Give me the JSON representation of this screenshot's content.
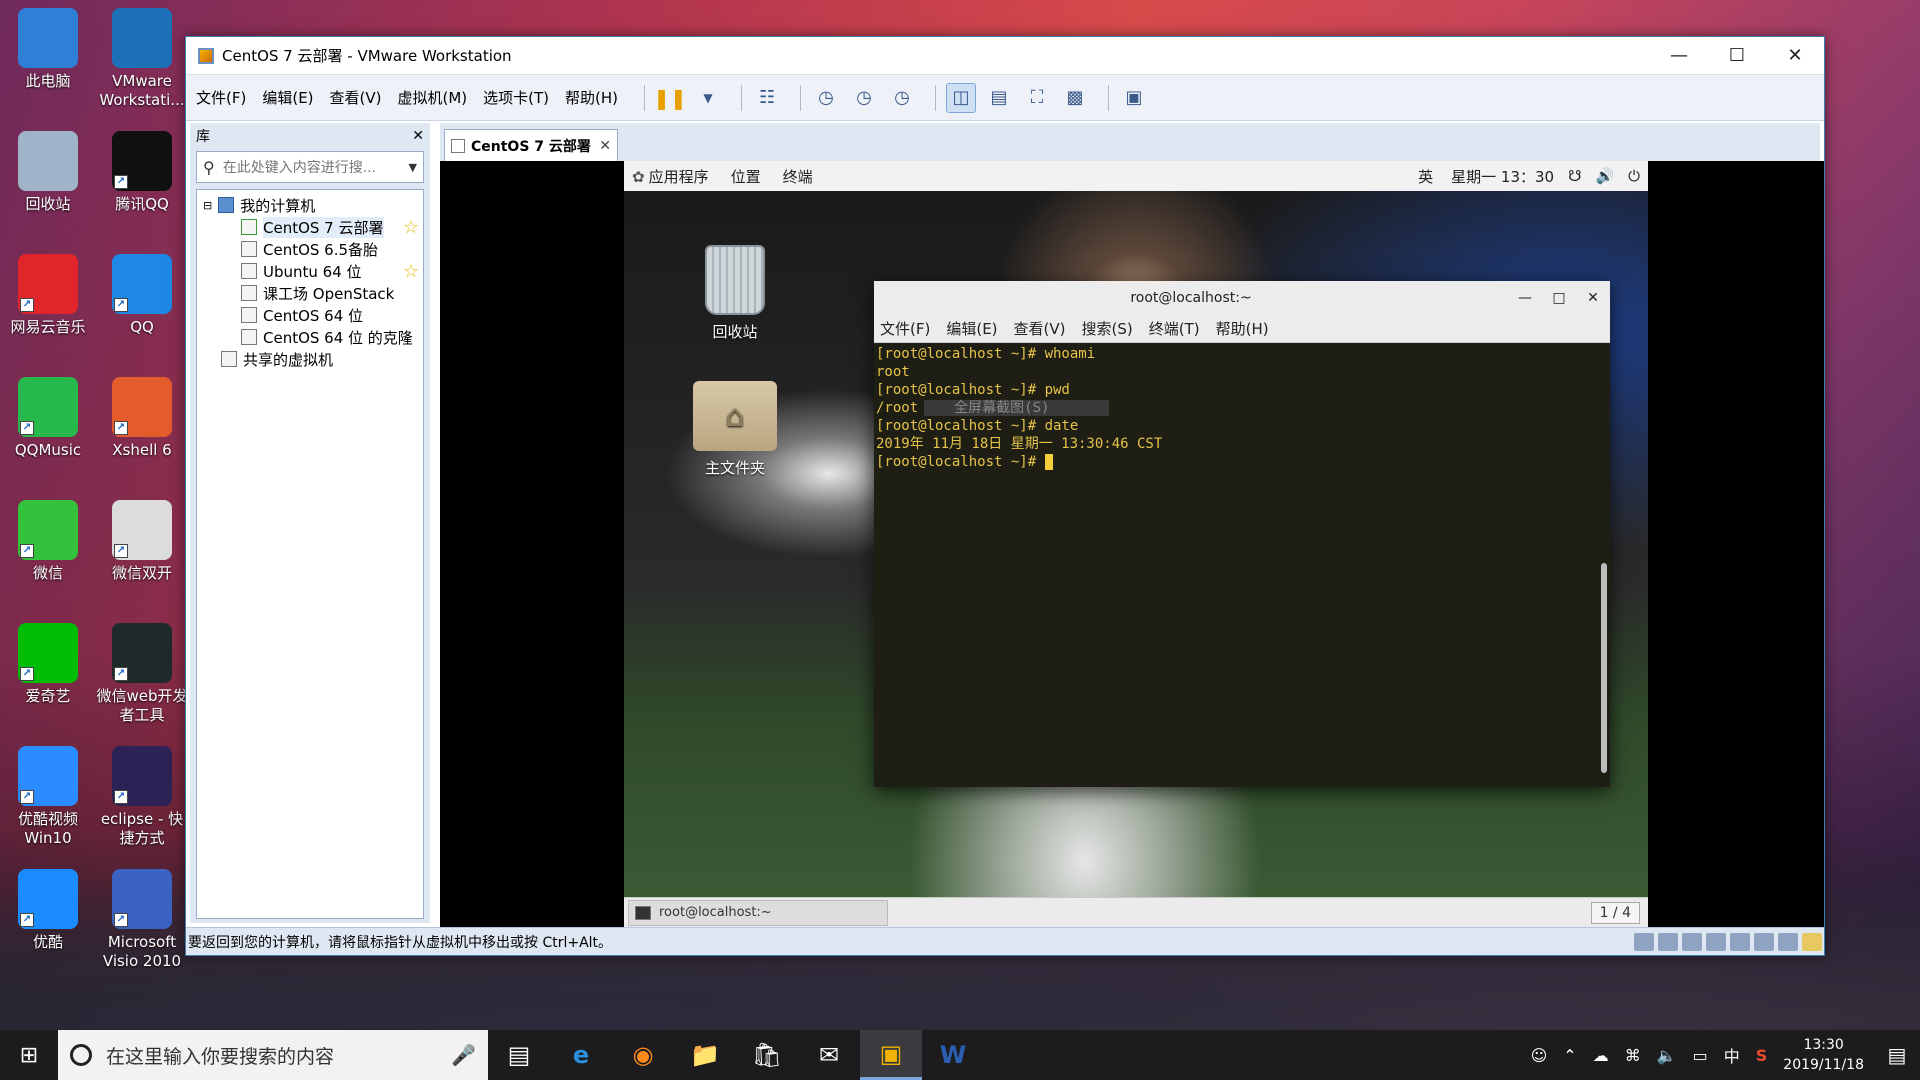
{
  "desktop": {
    "icons": [
      {
        "label": "此电脑",
        "icon": "this-pc-icon",
        "color": "#2f7fd6"
      },
      {
        "label": "VMware Workstati...",
        "icon": "vmware-icon",
        "color": "#1d6fb8"
      },
      {
        "label": "回收站",
        "icon": "recycle-bin-icon",
        "color": "#9fb4c8"
      },
      {
        "label": "腾讯QQ",
        "icon": "qq-penguin-icon",
        "color": "#111111"
      },
      {
        "label": "网易云音乐",
        "icon": "netease-music-icon",
        "color": "#e0262a"
      },
      {
        "label": "QQ",
        "icon": "qq-icon",
        "color": "#1e88e5"
      },
      {
        "label": "QQMusic",
        "icon": "qqmusic-icon",
        "color": "#27b94c"
      },
      {
        "label": "Xshell 6",
        "icon": "xshell-icon",
        "color": "#e45c2c"
      },
      {
        "label": "微信",
        "icon": "wechat-icon",
        "color": "#32c23c"
      },
      {
        "label": "微信双开",
        "icon": "wechat-dual-icon",
        "color": "#dcdcdc"
      },
      {
        "label": "爱奇艺",
        "icon": "iqiyi-icon",
        "color": "#00be06"
      },
      {
        "label": "微信web开发者工具",
        "icon": "wechat-devtools-icon",
        "color": "#1f2a2a"
      },
      {
        "label": "优酷视频 Win10",
        "icon": "youku-win10-icon",
        "color": "#2b8cff"
      },
      {
        "label": "eclipse - 快捷方式",
        "icon": "eclipse-icon",
        "color": "#2c2255"
      },
      {
        "label": "优酷",
        "icon": "youku-icon",
        "color": "#1a8cff"
      },
      {
        "label": "Microsoft Visio 2010",
        "icon": "visio-icon",
        "color": "#3b63c4"
      }
    ]
  },
  "vmware": {
    "title": "CentOS 7 云部署 - VMware Workstation",
    "menu": [
      "文件(F)",
      "编辑(E)",
      "查看(V)",
      "虚拟机(M)",
      "选项卡(T)",
      "帮助(H)"
    ],
    "library": {
      "title": "库",
      "search_placeholder": "在此处键入内容进行搜...",
      "root": "我的计算机",
      "vms": [
        {
          "name": "CentOS 7 云部署",
          "starred": true
        },
        {
          "name": "CentOS 6.5备胎",
          "starred": false
        },
        {
          "name": "Ubuntu 64 位",
          "starred": true
        },
        {
          "name": "课工场 OpenStack",
          "starred": false
        },
        {
          "name": "CentOS 64 位",
          "starred": false
        },
        {
          "name": "CentOS 64 位 的克隆",
          "starred": false
        }
      ],
      "shared": "共享的虚拟机"
    },
    "tab_label": "CentOS 7 云部署",
    "status_text": "要返回到您的计算机，请将鼠标指针从虚拟机中移出或按 Ctrl+Alt。"
  },
  "guest": {
    "topbar": {
      "apps": "应用程序",
      "places": "位置",
      "terminal": "终端",
      "lang": "英",
      "clock": "星期一 13：30"
    },
    "desktop_icons": [
      "回收站",
      "主文件夹"
    ],
    "terminal": {
      "title": "root@localhost:~",
      "menu": [
        "文件(F)",
        "编辑(E)",
        "查看(V)",
        "搜索(S)",
        "终端(T)",
        "帮助(H)"
      ],
      "lines": [
        "[root@localhost ~]# whoami",
        "root",
        "[root@localhost ~]# pwd",
        "/root",
        "[root@localhost ~]# date",
        "2019年 11月 18日 星期一 13:30:46 CST",
        "[root@localhost ~]# "
      ],
      "overlay_hint": "全屏幕截图(S)"
    },
    "taskbar_item": "root@localhost:~",
    "workspace": "1 / 4"
  },
  "taskbar": {
    "search_placeholder": "在这里输入你要搜索的内容",
    "time": "13:30",
    "date": "2019/11/18",
    "ime": "中"
  }
}
